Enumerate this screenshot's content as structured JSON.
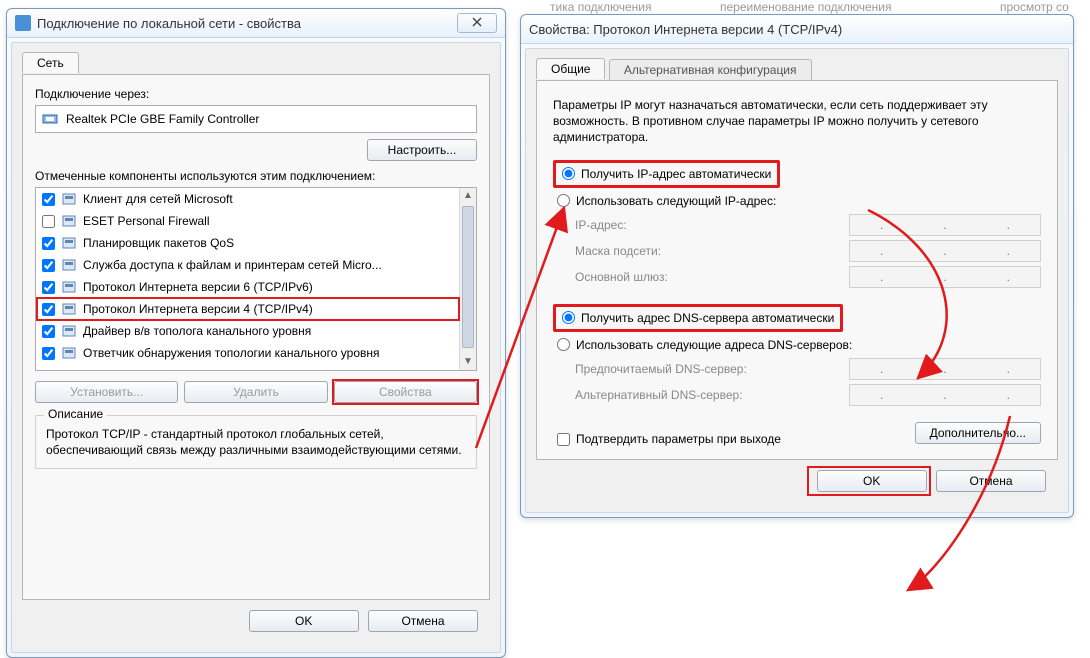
{
  "topbar": {
    "t1": "тика подключения",
    "t2": "переименование подключения",
    "t3": "просмотр со"
  },
  "leftWindow": {
    "title": "Подключение по локальной сети - свойства",
    "tab_network": "Сеть",
    "connect_via_label": "Подключение через:",
    "adapter_name": "Realtek PCIe GBE Family Controller",
    "configure_btn": "Настроить...",
    "components_label": "Отмеченные компоненты используются этим подключением:",
    "items": [
      {
        "checked": true,
        "label": "Клиент для сетей Microsoft"
      },
      {
        "checked": false,
        "label": "ESET Personal Firewall"
      },
      {
        "checked": true,
        "label": "Планировщик пакетов QoS"
      },
      {
        "checked": true,
        "label": "Служба доступа к файлам и принтерам сетей Micro..."
      },
      {
        "checked": true,
        "label": "Протокол Интернета версии 6 (TCP/IPv6)"
      },
      {
        "checked": true,
        "label": "Протокол Интернета версии 4 (TCP/IPv4)"
      },
      {
        "checked": true,
        "label": "Драйвер в/в тополога канального уровня"
      },
      {
        "checked": true,
        "label": "Ответчик обнаружения топологии канального уровня"
      }
    ],
    "install_btn": "Установить...",
    "remove_btn": "Удалить",
    "properties_btn": "Свойства",
    "desc_legend": "Описание",
    "desc_text": "Протокол TCP/IP - стандартный протокол глобальных сетей, обеспечивающий связь между различными взаимодействующими сетями.",
    "ok_btn": "OK",
    "cancel_btn": "Отмена"
  },
  "rightWindow": {
    "title": "Свойства: Протокол Интернета версии 4 (TCP/IPv4)",
    "tab_general": "Общие",
    "tab_alt": "Альтернативная конфигурация",
    "intro": "Параметры IP могут назначаться автоматически, если сеть поддерживает эту возможность. В противном случае параметры IP можно получить у сетевого администратора.",
    "radio_auto_ip": "Получить IP-адрес автоматически",
    "radio_manual_ip": "Использовать следующий IP-адрес:",
    "ip_label": "IP-адрес:",
    "mask_label": "Маска подсети:",
    "gw_label": "Основной шлюз:",
    "radio_auto_dns": "Получить адрес DNS-сервера автоматически",
    "radio_manual_dns": "Использовать следующие адреса DNS-серверов:",
    "dns_pref_label": "Предпочитаемый DNS-сервер:",
    "dns_alt_label": "Альтернативный DNS-сервер:",
    "confirm_chk": "Подтвердить параметры при выходе",
    "advanced_btn": "Дополнительно...",
    "ok_btn": "OK",
    "cancel_btn": "Отмена"
  }
}
